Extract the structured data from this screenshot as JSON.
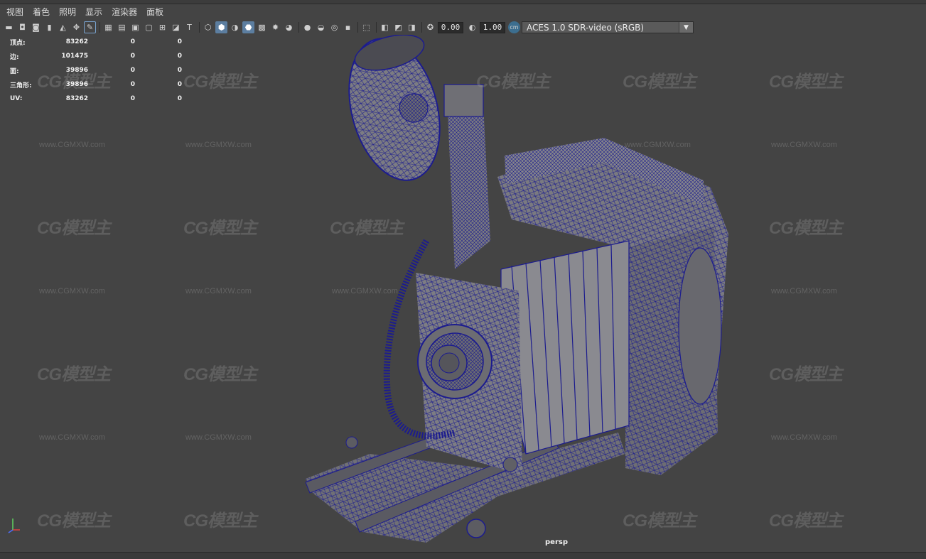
{
  "menu": [
    "视图",
    "着色",
    "照明",
    "显示",
    "渲染器",
    "面板"
  ],
  "toolbar": {
    "exposure_value": "0.00",
    "gamma_value": "1.00",
    "color_management": "ACES 1.0 SDR-video (sRGB)"
  },
  "hud": {
    "rows": [
      {
        "label": "顶点:",
        "v1": "83262",
        "v2": "0",
        "v3": "0"
      },
      {
        "label": "边:",
        "v1": "101475",
        "v2": "0",
        "v3": "0"
      },
      {
        "label": "面:",
        "v1": "39896",
        "v2": "0",
        "v3": "0"
      },
      {
        "label": "三角形:",
        "v1": "39896",
        "v2": "0",
        "v3": "0"
      },
      {
        "label": "UV:",
        "v1": "83262",
        "v2": "0",
        "v3": "0"
      }
    ]
  },
  "camera_label": "persp",
  "watermark": {
    "logo": "CG模型主",
    "url": "www.CGMXW.com"
  },
  "colors": {
    "viewport_bg": "#444444",
    "wireframe": "#1a1a8c",
    "model_fill": "#6e6e74"
  }
}
